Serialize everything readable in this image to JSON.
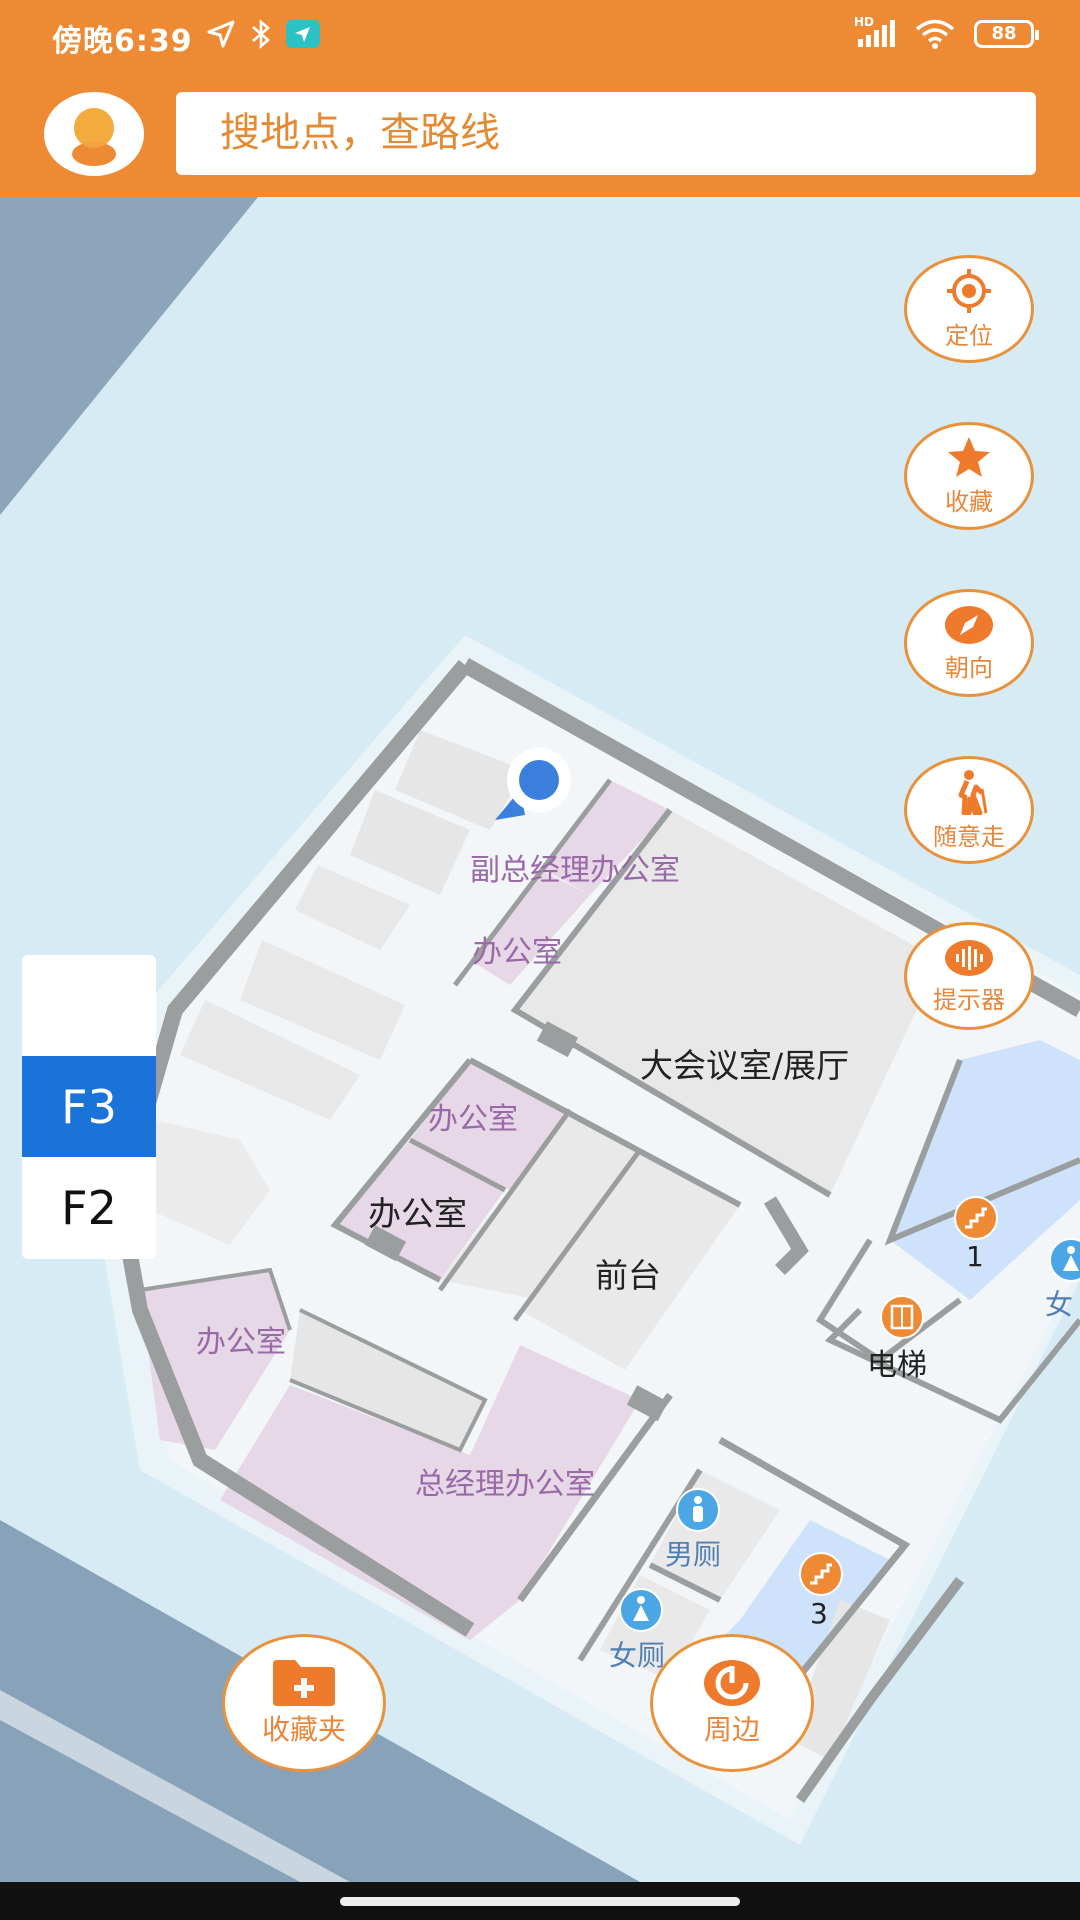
{
  "status_bar": {
    "time": "傍晚6:39",
    "battery": "88",
    "signal_label": "HD"
  },
  "search": {
    "placeholder": "搜地点，查路线"
  },
  "side_buttons": {
    "locate": "定位",
    "favorite": "收藏",
    "orientation": "朝向",
    "walk": "随意走",
    "prompter": "提示器"
  },
  "floors": {
    "blank": "",
    "f3": "F3",
    "f2": "F2",
    "active": "F3"
  },
  "map_labels": {
    "vice_gm_office": "副总经理办公室",
    "office_1": "办公室",
    "meeting_hall": "大会议室/展厅",
    "office_2": "办公室",
    "office_3": "办公室",
    "reception": "前台",
    "office_4": "办公室",
    "gm_office": "总经理办公室",
    "elevator": "电梯",
    "mens_restroom": "男厕",
    "womens_restroom": "女厕",
    "womens_restroom_partial": "女",
    "stairs_1": "1",
    "stairs_3": "3"
  },
  "bottom_buttons": {
    "folder": "收藏夹",
    "nearby": "周边"
  },
  "colors": {
    "accent": "#ee8a34",
    "floor_active": "#1a73d9",
    "room_purple": "#e7dae6",
    "room_blue": "#cfe2fb"
  }
}
